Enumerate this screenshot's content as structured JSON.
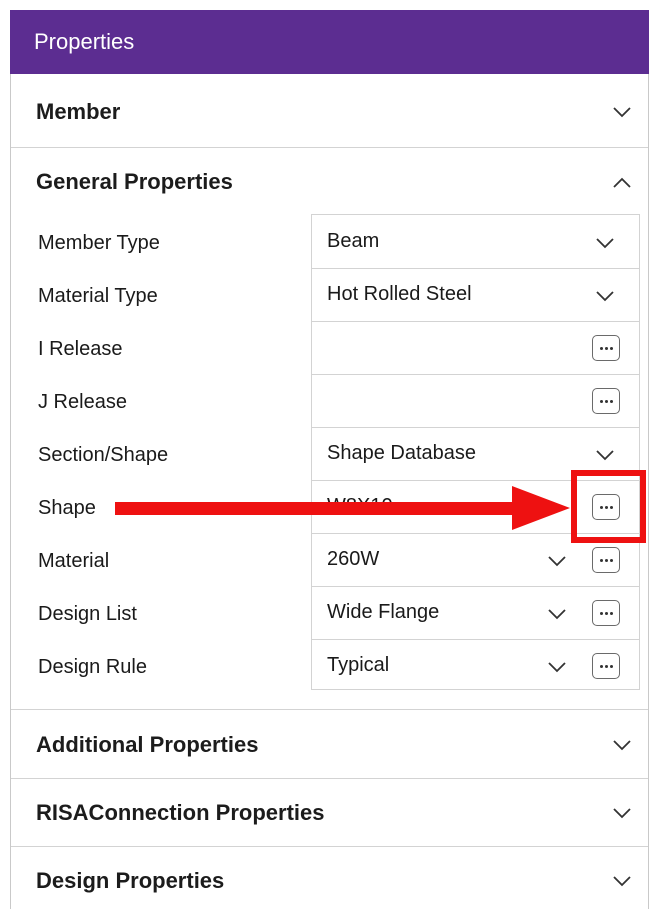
{
  "title": "Properties",
  "sections": {
    "member": "Member",
    "general": "General Properties",
    "additional": "Additional Properties",
    "risa_connection": "RISAConnection Properties",
    "design": "Design Properties"
  },
  "general_properties": {
    "member_type": {
      "label": "Member Type",
      "value": "Beam"
    },
    "material_type": {
      "label": "Material Type",
      "value": "Hot Rolled Steel"
    },
    "i_release": {
      "label": "I Release",
      "value": ""
    },
    "j_release": {
      "label": "J Release",
      "value": ""
    },
    "section_shape": {
      "label": "Section/Shape",
      "value": "Shape Database"
    },
    "shape": {
      "label": "Shape",
      "value": "W8X10"
    },
    "material": {
      "label": "Material",
      "value": "260W"
    },
    "design_list": {
      "label": "Design List",
      "value": "Wide Flange"
    },
    "design_rule": {
      "label": "Design Rule",
      "value": "Typical"
    }
  },
  "colors": {
    "title_bar": "#5c2d91",
    "annotation": "#ee1111"
  },
  "icons": {
    "chevron_down": "chevron-down-icon",
    "chevron_up": "chevron-up-icon",
    "ellipsis": "ellipsis-icon"
  }
}
